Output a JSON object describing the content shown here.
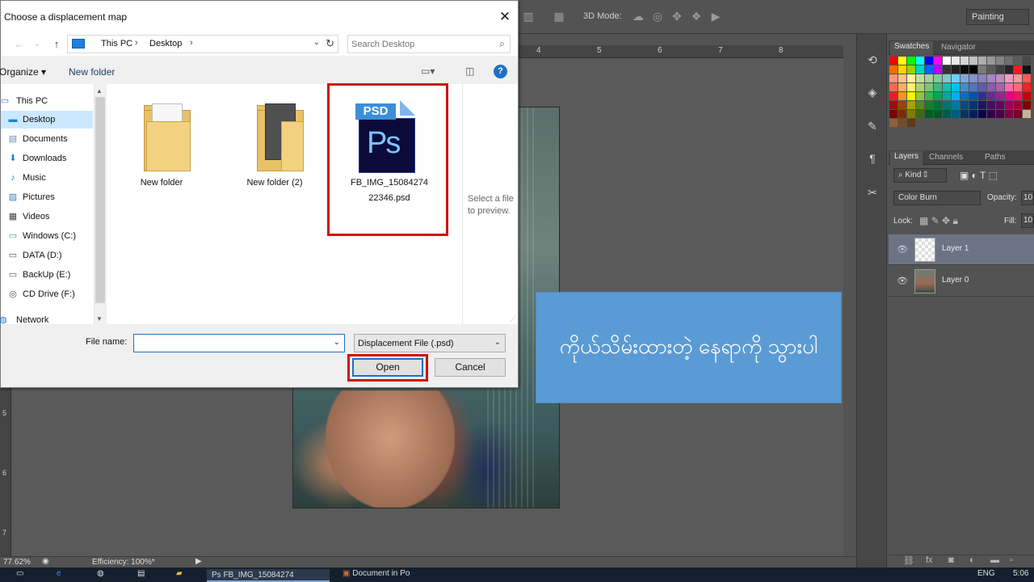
{
  "dialog": {
    "title": "Choose a displacement map",
    "close_label": "✕",
    "address": {
      "root": "This PC",
      "folder": "Desktop"
    },
    "search_placeholder": "Search Desktop",
    "toolbar": {
      "organize": "Organize ▾",
      "new_folder": "New folder",
      "help": "?"
    },
    "nav_pane": [
      {
        "label": "This PC",
        "icon": "pc-icon"
      },
      {
        "label": "Desktop",
        "icon": "desktop-icon",
        "selected": true
      },
      {
        "label": "Documents",
        "icon": "documents-icon"
      },
      {
        "label": "Downloads",
        "icon": "downloads-icon"
      },
      {
        "label": "Music",
        "icon": "music-icon"
      },
      {
        "label": "Pictures",
        "icon": "pictures-icon"
      },
      {
        "label": "Videos",
        "icon": "videos-icon"
      },
      {
        "label": "Windows (C:)",
        "icon": "drive-icon"
      },
      {
        "label": "DATA (D:)",
        "icon": "drive-icon"
      },
      {
        "label": "BackUp (E:)",
        "icon": "drive-icon"
      },
      {
        "label": "CD Drive (F:)",
        "icon": "cd-drive-icon"
      },
      {
        "label": "Network",
        "icon": "network-icon"
      }
    ],
    "files": [
      {
        "name": "New folder",
        "type": "folder"
      },
      {
        "name": "New folder (2)",
        "type": "folder"
      },
      {
        "name_line1": "FB_IMG_15084274",
        "name_line2": "22346.psd",
        "type": "psd",
        "badge": "PSD",
        "glyph": "Ps"
      }
    ],
    "preview_text_line1": "Select a file",
    "preview_text_line2": "to preview.",
    "file_name_label": "File name:",
    "file_name_value": "",
    "file_type": "Displacement File (.psd)",
    "open_label": "Open",
    "cancel_label": "Cancel",
    "highlight_color": "#d10d0d"
  },
  "photoshop": {
    "mode_3d": "3D Mode:",
    "workspace": "Painting",
    "ruler_top": [
      "4",
      "5",
      "6",
      "7",
      "8"
    ],
    "ruler_left": [
      "5",
      "6",
      "7"
    ],
    "panel_tabs_top": [
      "Swatches",
      "Navigator"
    ],
    "panel_tabs_layers": [
      "Layers",
      "Channels",
      "Paths"
    ],
    "kind_filter": "Kind",
    "blend_mode": "Color Burn",
    "opacity_label": "Opacity:",
    "opacity_value": "10",
    "lock_label": "Lock:",
    "fill_label": "Fill:",
    "fill_value": "10",
    "layers": [
      {
        "name": "Layer 1",
        "active": true
      },
      {
        "name": "Layer 0",
        "active": false
      }
    ],
    "status": {
      "zoom": "77.62%",
      "info": "Efficiency: 100%*"
    }
  },
  "caption": {
    "text": "ကိုယ်သိမ်းထားတဲ့ နေရာကို သွားပါ",
    "bg_color": "#5b9bd5"
  },
  "taskbar": {
    "active_item": "FB_IMG_15084274",
    "second_item": "Document in Po",
    "lang": "ENG",
    "time": "5:06"
  }
}
